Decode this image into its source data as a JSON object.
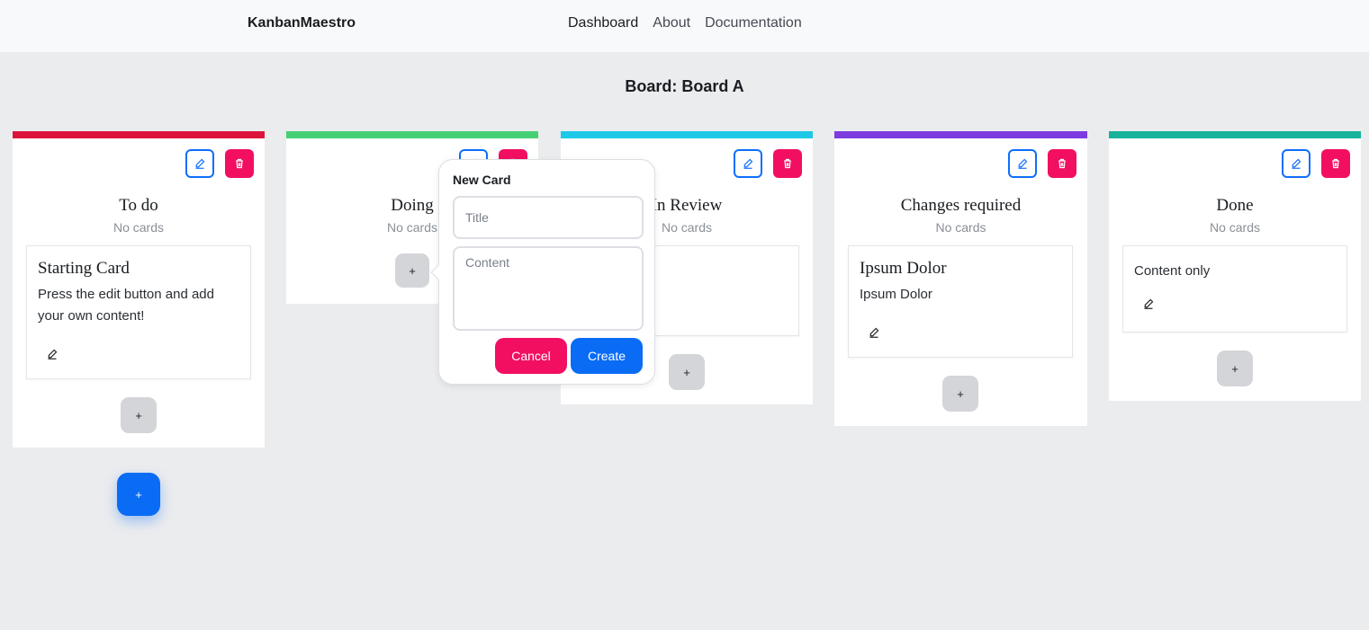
{
  "app": {
    "brand": "KanbanMaestro"
  },
  "nav": {
    "links": [
      "Dashboard",
      "About",
      "Documentation"
    ]
  },
  "board": {
    "title": "Board: Board A"
  },
  "colors": {
    "todo": "#dc143c",
    "doing": "#45d075",
    "review": "#1ec9e8",
    "changes": "#7d3be0",
    "done": "#17b39a",
    "primary": "#0a6cf5",
    "danger": "#f20f62"
  },
  "columns": [
    {
      "title": "To do",
      "count_label": "No cards",
      "cards": [
        {
          "title": "Starting Card",
          "content": "Press the edit button and add your own content!"
        }
      ]
    },
    {
      "title": "Doing",
      "count_label": "No cards",
      "cards": []
    },
    {
      "title": "In Review",
      "count_label": "No cards",
      "cards": [
        {
          "title": "",
          "content": ""
        }
      ]
    },
    {
      "title": "Changes required",
      "count_label": "No cards",
      "cards": [
        {
          "title": "Ipsum Dolor",
          "content": "Ipsum Dolor"
        }
      ]
    },
    {
      "title": "Done",
      "count_label": "No cards",
      "cards": [
        {
          "title": "",
          "content": "Content only"
        }
      ]
    }
  ],
  "add_card_icon": "+",
  "fab_icon": "+",
  "new_card_popover": {
    "title": "New Card",
    "title_placeholder": "Title",
    "content_placeholder": "Content",
    "cancel_label": "Cancel",
    "create_label": "Create"
  }
}
